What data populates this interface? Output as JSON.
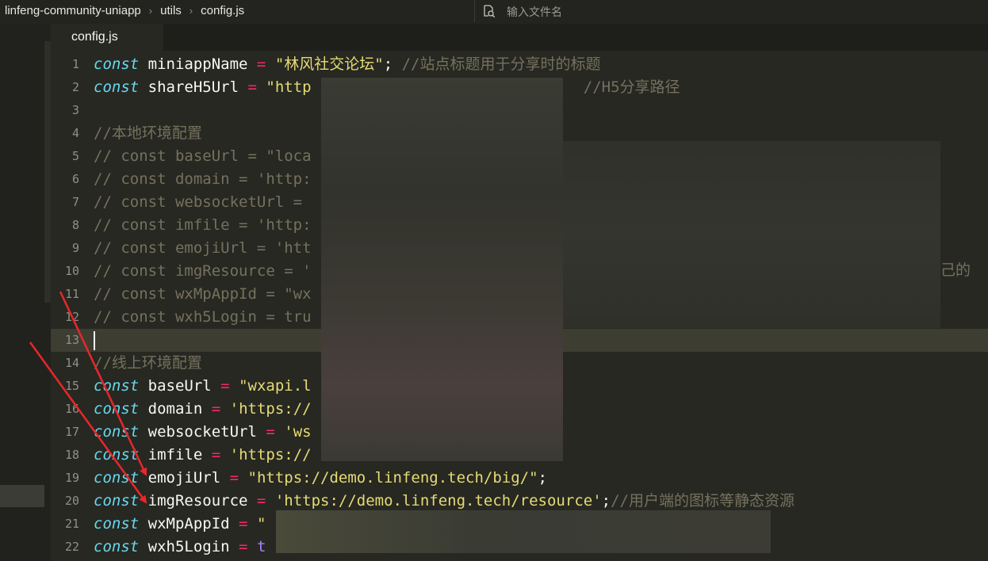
{
  "breadcrumb": {
    "project": "linfeng-community-uniapp",
    "folder": "utils",
    "file": "config.js"
  },
  "search": {
    "placeholder": "输入文件名"
  },
  "tab": {
    "label": "config.js"
  },
  "partial_text": "己的",
  "lines": [
    {
      "n": "1",
      "seg": [
        [
          "kw",
          "const"
        ],
        [
          "p",
          " miniappName "
        ],
        [
          "op",
          "="
        ],
        [
          "p",
          " "
        ],
        [
          "str",
          "\"林风社交论坛\""
        ],
        [
          "p",
          "; "
        ],
        [
          "cm",
          "//站点标题用于分享时的标题"
        ]
      ]
    },
    {
      "n": "2",
      "seg": [
        [
          "kw",
          "const"
        ],
        [
          "p",
          " shareH5Url "
        ],
        [
          "op",
          "="
        ],
        [
          "p",
          " "
        ],
        [
          "str",
          "\"http"
        ],
        [
          "p",
          "                              "
        ],
        [
          "cm",
          "//H5分享路径"
        ]
      ]
    },
    {
      "n": "3",
      "seg": []
    },
    {
      "n": "4",
      "seg": [
        [
          "cm",
          "//本地环境配置"
        ]
      ]
    },
    {
      "n": "5",
      "seg": [
        [
          "cm",
          "// const baseUrl = \"loca"
        ]
      ]
    },
    {
      "n": "6",
      "seg": [
        [
          "cm",
          "// const domain = 'http:"
        ]
      ]
    },
    {
      "n": "7",
      "seg": [
        [
          "cm",
          "// const websocketUrl = "
        ]
      ]
    },
    {
      "n": "8",
      "seg": [
        [
          "cm",
          "// const imfile = 'http:"
        ]
      ]
    },
    {
      "n": "9",
      "seg": [
        [
          "cm",
          "// const emojiUrl = 'htt"
        ]
      ]
    },
    {
      "n": "10",
      "seg": [
        [
          "cm",
          "// const imgResource = '"
        ]
      ]
    },
    {
      "n": "11",
      "seg": [
        [
          "cm",
          "// const wxMpAppId = \"wx"
        ]
      ]
    },
    {
      "n": "12",
      "seg": [
        [
          "cm",
          "// const wxh5Login = tru"
        ]
      ]
    },
    {
      "n": "13",
      "seg": [],
      "current": true
    },
    {
      "n": "14",
      "seg": [
        [
          "cm",
          "//线上环境配置"
        ]
      ]
    },
    {
      "n": "15",
      "seg": [
        [
          "kw",
          "const"
        ],
        [
          "p",
          " baseUrl "
        ],
        [
          "op",
          "="
        ],
        [
          "p",
          " "
        ],
        [
          "str",
          "\"wxapi.l"
        ]
      ]
    },
    {
      "n": "16",
      "seg": [
        [
          "kw",
          "const"
        ],
        [
          "p",
          " domain "
        ],
        [
          "op",
          "="
        ],
        [
          "p",
          " "
        ],
        [
          "str",
          "'https://"
        ]
      ]
    },
    {
      "n": "17",
      "seg": [
        [
          "kw",
          "const"
        ],
        [
          "p",
          " websocketUrl "
        ],
        [
          "op",
          "="
        ],
        [
          "p",
          " "
        ],
        [
          "str",
          "'ws"
        ]
      ]
    },
    {
      "n": "18",
      "seg": [
        [
          "kw",
          "const"
        ],
        [
          "p",
          " imfile "
        ],
        [
          "op",
          "="
        ],
        [
          "p",
          " "
        ],
        [
          "str",
          "'https://"
        ]
      ]
    },
    {
      "n": "19",
      "seg": [
        [
          "kw",
          "const"
        ],
        [
          "p",
          " emojiUrl "
        ],
        [
          "op",
          "="
        ],
        [
          "p",
          " "
        ],
        [
          "str",
          "\"https://demo.linfeng.tech/big/\""
        ],
        [
          "p",
          ";"
        ]
      ]
    },
    {
      "n": "20",
      "seg": [
        [
          "kw",
          "const"
        ],
        [
          "p",
          " imgResource "
        ],
        [
          "op",
          "="
        ],
        [
          "p",
          " "
        ],
        [
          "str",
          "'https://demo.linfeng.tech/resource'"
        ],
        [
          "p",
          ";"
        ],
        [
          "cm",
          "//用户端的图标等静态资源"
        ]
      ]
    },
    {
      "n": "21",
      "seg": [
        [
          "kw",
          "const"
        ],
        [
          "p",
          " wxMpAppId "
        ],
        [
          "op",
          "="
        ],
        [
          "p",
          " "
        ],
        [
          "str",
          "\""
        ]
      ]
    },
    {
      "n": "22",
      "seg": [
        [
          "kw",
          "const"
        ],
        [
          "p",
          " wxh5Login "
        ],
        [
          "op",
          "="
        ],
        [
          "p",
          " "
        ],
        [
          "bool",
          "t"
        ]
      ]
    }
  ],
  "colors": {
    "background": "#272822",
    "keyword": "#66d9ef",
    "operator": "#f92672",
    "string": "#e6db74",
    "comment": "#75715e",
    "boolean": "#ae81ff",
    "arrow": "#e8272a"
  }
}
